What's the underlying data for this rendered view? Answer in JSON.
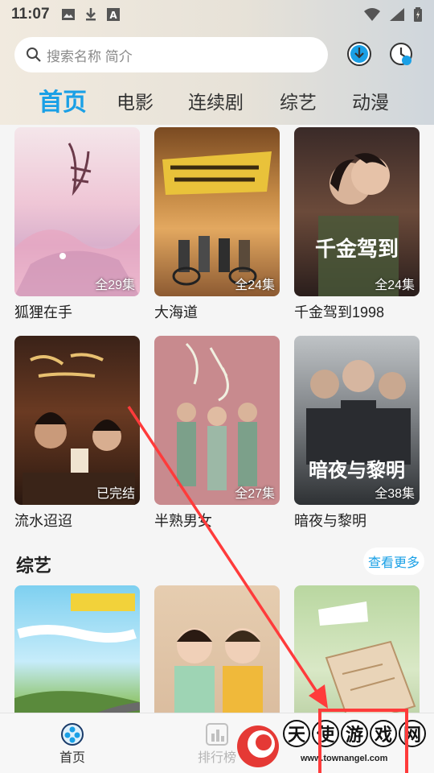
{
  "status_bar": {
    "time": "11:07"
  },
  "search": {
    "placeholder": "搜索名称 简介"
  },
  "tabs": [
    {
      "label": "首页",
      "active": true
    },
    {
      "label": "电影",
      "active": false
    },
    {
      "label": "连续剧",
      "active": false
    },
    {
      "label": "综艺",
      "active": false
    },
    {
      "label": "动漫",
      "active": false
    }
  ],
  "shows": [
    {
      "title": "狐狸在手",
      "badge": "全29集"
    },
    {
      "title": "大海道",
      "badge": "全24集"
    },
    {
      "title": "千金驾到1998",
      "badge": "全24集"
    },
    {
      "title": "流水迢迢",
      "badge": "已完结"
    },
    {
      "title": "半熟男女",
      "badge": "全27集"
    },
    {
      "title": "暗夜与黎明",
      "badge": "全38集"
    }
  ],
  "variety": {
    "section_title": "综艺",
    "more_label": "查看更多"
  },
  "bottom_nav": [
    {
      "label": "首页",
      "active": true
    },
    {
      "label": "排行榜",
      "active": false
    }
  ],
  "watermark": {
    "chars": [
      "天",
      "使",
      "游",
      "戏",
      "网"
    ],
    "url": "www.townangel.com"
  },
  "colors": {
    "accent": "#1aa0e6",
    "annotation": "#ff3b3b"
  }
}
